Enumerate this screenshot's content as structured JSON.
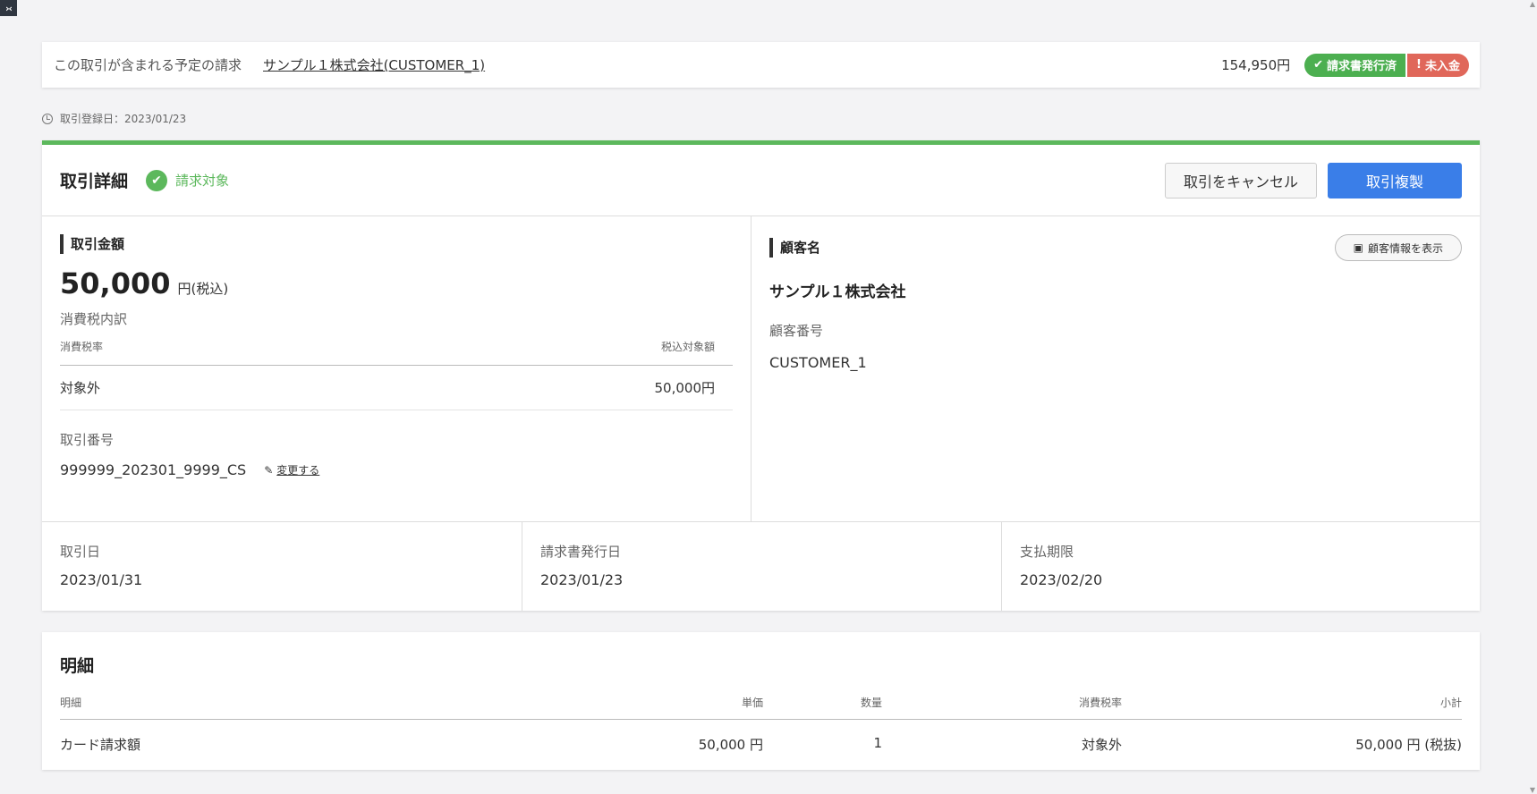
{
  "invoice_bar": {
    "label": "この取引が含まれる予定の請求",
    "customer_link": "サンプル１株式会社(CUSTOMER_1)",
    "amount": "154,950円",
    "badge_issued": "請求書発行済",
    "badge_unpaid": "未入金"
  },
  "registration": {
    "text": "取引登録日：2023/01/23"
  },
  "detail": {
    "title": "取引詳細",
    "status": "請求対象",
    "cancel_button": "取引をキャンセル",
    "duplicate_button": "取引複製",
    "amount_section": {
      "title": "取引金額",
      "amount": "50,000",
      "unit": "円(税込)",
      "tax_breakdown_label": "消費税内訳",
      "table_headers": [
        "消費税率",
        "税込対象額"
      ],
      "rows": [
        {
          "rate": "対象外",
          "amount": "50,000円"
        }
      ]
    },
    "transaction_number": {
      "label": "取引番号",
      "value": "999999_202301_9999_CS",
      "change_link": "変更する"
    },
    "customer_section": {
      "title": "顧客名",
      "show_button": "顧客情報を表示",
      "name": "サンプル１株式会社",
      "number_label": "顧客番号",
      "number": "CUSTOMER_1"
    },
    "dates": {
      "transaction_date_label": "取引日",
      "transaction_date": "2023/01/31",
      "invoice_date_label": "請求書発行日",
      "invoice_date": "2023/01/23",
      "due_date_label": "支払期限",
      "due_date": "2023/02/20"
    }
  },
  "line_items": {
    "title": "明細",
    "headers": {
      "item": "明細",
      "unit_price": "単価",
      "quantity": "数量",
      "tax_rate": "消費税率",
      "subtotal": "小計"
    },
    "rows": [
      {
        "item": "カード請求額",
        "unit_price": "50,000 円",
        "quantity": "1",
        "tax_rate": "対象外",
        "subtotal": "50,000 円 (税抜)"
      }
    ]
  },
  "colors": {
    "accent_green": "#5cb85c",
    "primary_blue": "#3a7ee8",
    "unpaid_red": "#e0675a"
  }
}
